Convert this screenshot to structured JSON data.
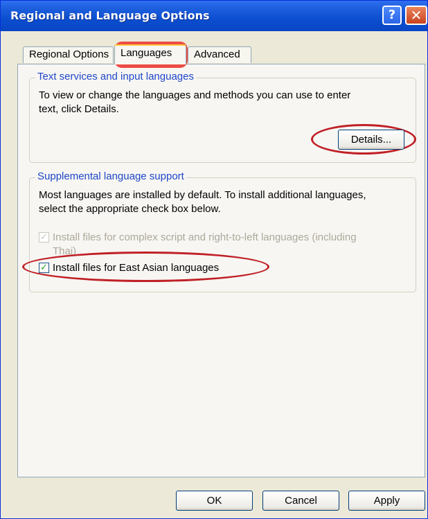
{
  "window": {
    "title": "Regional and Language Options",
    "help_glyph": "?",
    "close_glyph": "✕"
  },
  "tabs": [
    {
      "label": "Regional Options"
    },
    {
      "label": "Languages"
    },
    {
      "label": "Advanced"
    }
  ],
  "text_services": {
    "legend": "Text services and input languages",
    "desc_line1": "To view or change the languages and methods you can use to enter",
    "desc_line2": "text, click Details.",
    "details_button": "Details..."
  },
  "supplemental": {
    "legend": "Supplemental language support",
    "desc_line1": "Most languages are installed by default. To install additional languages,",
    "desc_line2": "select the appropriate check box below.",
    "complex_line1": "Install files for complex script and right-to-left languages (including",
    "complex_line2": "Thai)",
    "complex_checked": true,
    "complex_enabled": false,
    "east_asian_label": "Install files for East Asian languages",
    "east_asian_checked": true,
    "check_glyph": "✓"
  },
  "buttons": {
    "ok": "OK",
    "cancel": "Cancel",
    "apply": "Apply"
  },
  "colors": {
    "titlebar": "#0a46c4",
    "annotation_red": "#c02026",
    "legend_blue": "#1f46c8"
  }
}
